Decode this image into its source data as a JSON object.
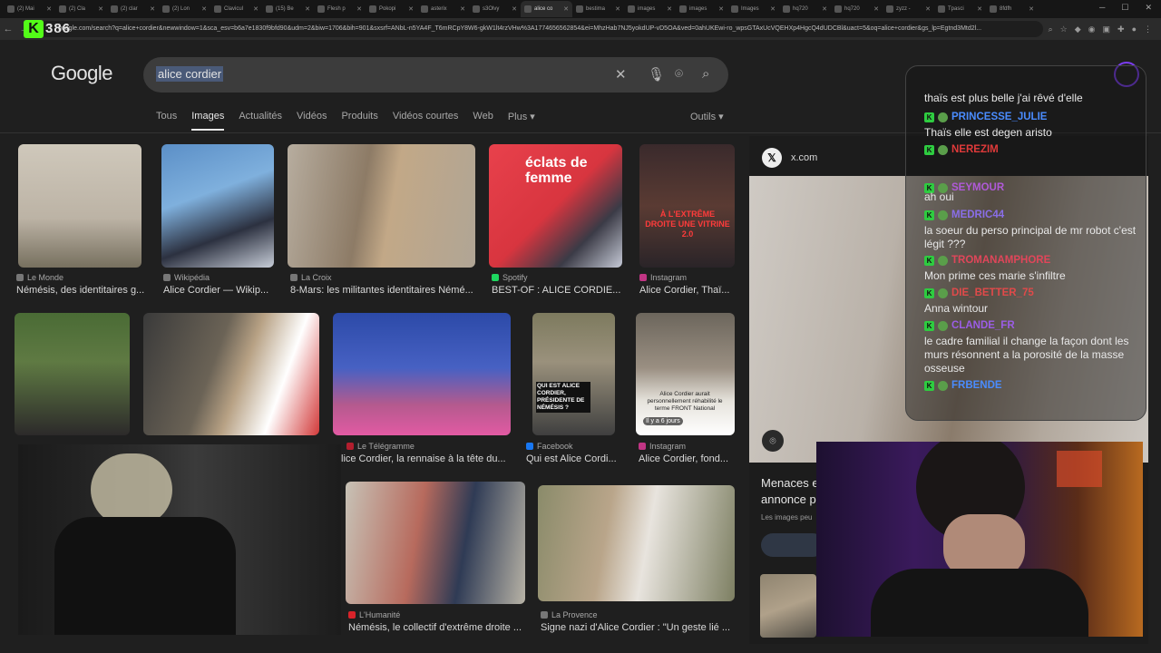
{
  "browser": {
    "tabs": [
      {
        "label": "(2) Mai"
      },
      {
        "label": "(2) Cla"
      },
      {
        "label": "(2) clar"
      },
      {
        "label": "(2) Lon"
      },
      {
        "label": "Clavicul"
      },
      {
        "label": "(15) Be"
      },
      {
        "label": "Flesh p"
      },
      {
        "label": "Pokopi"
      },
      {
        "label": "asterix"
      },
      {
        "label": "s3Olvy"
      },
      {
        "label": "alice co",
        "active": true
      },
      {
        "label": "bestima"
      },
      {
        "label": "images"
      },
      {
        "label": "images"
      },
      {
        "label": "Images"
      },
      {
        "label": "hq720"
      },
      {
        "label": "hq720"
      },
      {
        "label": "zyzz - "
      },
      {
        "label": "Tpasci"
      },
      {
        "label": "8fdfh"
      }
    ],
    "url": "google.com/search?q=alice+cordier&newwindow=1&sca_esv=b6a7e1830f9bfd90&udm=2&biw=1706&bih=901&sxsrf=ANbL-n5YA4F_T6mRCpY8W6-gkW1lt4rzVHw%3A1774656562854&ei=MhzHab7NJ5yokdUP-vD5OA&ved=0ahUKEwi-ro_wpsGTAxUcVQEHXp4HgcQ4dUDCBl&uact=5&oq=alice+cordier&gs_lp=Egtnd3Mtd2l..."
  },
  "kick_overlay": {
    "logo": "K",
    "count": "386"
  },
  "google": {
    "logo": "Google",
    "query": "alice cordier",
    "tabs": [
      "Tous",
      "Images",
      "Actualités",
      "Vidéos",
      "Produits",
      "Vidéos courtes",
      "Web",
      "Plus ▾"
    ],
    "active_tab": "Images",
    "tools": "Outils ▾"
  },
  "results": [
    {
      "source": "Le Monde",
      "caption": "Némésis, des identitaires g..."
    },
    {
      "source": "Wikipédia",
      "caption": "Alice Cordier — Wikip..."
    },
    {
      "source": "La Croix",
      "caption": "8-Mars: les militantes identitaires Némé..."
    },
    {
      "source": "Spotify",
      "caption": "BEST-OF : ALICE CORDIE..."
    },
    {
      "source": "Instagram",
      "caption": "Alice Cordier, Thaï..."
    },
    {
      "source": "Le Télégramme",
      "caption": "lice Cordier, la rennaise à la tête du..."
    },
    {
      "source": "Facebook",
      "caption": "Qui est Alice Cordi..."
    },
    {
      "source": "Instagram",
      "caption": "Alice Cordier, fond..."
    },
    {
      "source": "L'Humanité",
      "caption": "Némésis, le collectif d'extrême droite ..."
    },
    {
      "source": "La Provence",
      "caption": "Signe nazi d'Alice Cordier : \"Un geste lié ..."
    }
  ],
  "thumbnail_texts": {
    "spotify_cover": "éclats de femme",
    "instagram_cover": "À L'EXTRÊME DROITE UNE VITRINE 2.0",
    "qui_est": "QUI EST ALICE CORDIER, PRÉSIDENTE DE NÉMÉSIS ?",
    "timestamp": "Il y a 6 jours",
    "sub_caption": "Alice Cordier aurait personnellement réhabilité le terme FRONT National"
  },
  "preview": {
    "site": "x.com",
    "title_line1": "Menaces e",
    "title_line2": "annonce p",
    "subtitle": "Les images peu"
  },
  "chat": [
    {
      "type": "msg",
      "text": "thaïs est plus belle j'ai rêvé d'elle"
    },
    {
      "type": "user",
      "name": "PRINCESSE_JULIE",
      "color": "#4a8cff"
    },
    {
      "type": "msg",
      "text": "Thaïs elle est degen aristo"
    },
    {
      "type": "user",
      "name": "NEREZIM",
      "color": "#e03a3a"
    },
    {
      "type": "user",
      "name": "SEYMOUR",
      "color": "#b05ad8"
    },
    {
      "type": "msg",
      "text": "ah oui"
    },
    {
      "type": "user",
      "name": "MEDRIC44",
      "color": "#8a6ee8"
    },
    {
      "type": "msg",
      "text": "la soeur du perso principal de mr robot c'est légit ???"
    },
    {
      "type": "user",
      "name": "TROMANAMPHORE",
      "color": "#e0465a"
    },
    {
      "type": "msg",
      "text": "Mon prime ces marie s'infiltre"
    },
    {
      "type": "user",
      "name": "DIE_BETTER_75",
      "color": "#e04a4a"
    },
    {
      "type": "msg",
      "text": "Anna wintour"
    },
    {
      "type": "user",
      "name": "CLANDE_FR",
      "color": "#9b5de5"
    },
    {
      "type": "msg",
      "text": "le cadre familial il change la façon dont les murs résonnent a la porosité de la masse osseuse"
    },
    {
      "type": "user",
      "name": "FRBENDE",
      "color": "#4a8cff"
    }
  ],
  "colors": {
    "page_bg": "#1f1f1f",
    "kick_green": "#53fc18",
    "search_highlight": "#4a5a78"
  }
}
